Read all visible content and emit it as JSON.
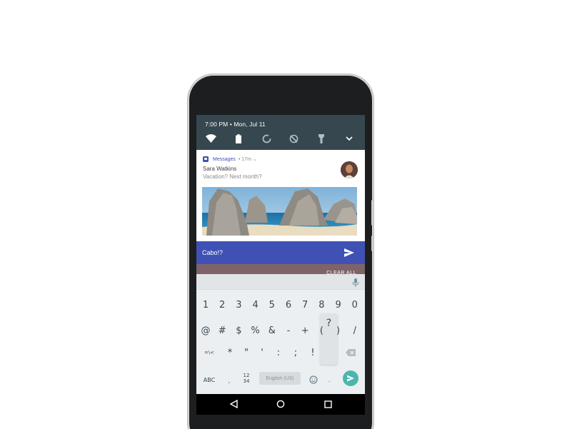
{
  "status": {
    "time_date": "7:00 PM • Mon, Jul 11"
  },
  "quick_settings": {
    "icons": [
      "wifi-icon",
      "battery-icon",
      "sync-icon",
      "do-not-disturb-icon",
      "flashlight-icon",
      "chevron-down-icon"
    ]
  },
  "notification": {
    "app_name": "Messages",
    "meta": "• 17m ⌄",
    "sender": "Sara Watkins",
    "message": "Vacation? Next month?",
    "image_icon": "beach-arch-photo"
  },
  "reply": {
    "value": "Cabo!?",
    "send_icon": "send-icon"
  },
  "peek": {
    "label": "CLEAR ALL"
  },
  "keyboard": {
    "row1": [
      "1",
      "2",
      "3",
      "4",
      "5",
      "6",
      "7",
      "8",
      "9",
      "0"
    ],
    "row2": [
      "@",
      "#",
      "$",
      "%",
      "&",
      "-",
      "+",
      "(",
      ")",
      "/"
    ],
    "row3": [
      "=\\<",
      "*",
      "\"",
      "'",
      ":",
      ";",
      "!"
    ],
    "popup_char": "?",
    "abc": "ABC",
    "comma": ",",
    "num_toggle_top": "12",
    "num_toggle_bottom": "34",
    "space": "English (US)",
    "period": ".",
    "icons": [
      "mic-icon",
      "backspace-icon",
      "emoji-icon",
      "enter-icon"
    ],
    "accent": "#4db6ac"
  },
  "navbar": {
    "icons": [
      "back-icon",
      "home-icon",
      "recents-icon"
    ]
  },
  "colors": {
    "qs_bg": "#37474f",
    "reply_bg": "#3f51b5",
    "keyboard_bg": "#eceff1"
  }
}
